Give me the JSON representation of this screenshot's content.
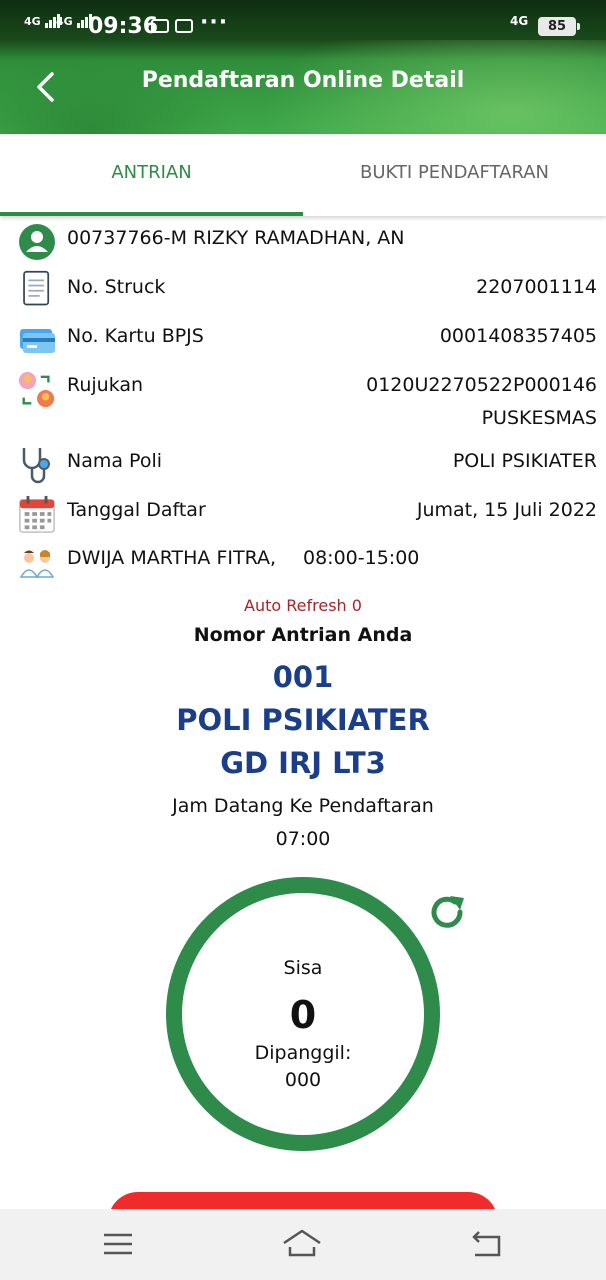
{
  "status_bar": {
    "signal1": "4G",
    "signal2": "4G",
    "time": "09:36",
    "more": "···",
    "network": "4G",
    "battery": "85"
  },
  "header": {
    "title": "Pendaftaran Online Detail",
    "back_icon": "back-arrow-icon"
  },
  "tabs": [
    {
      "label": "ANTRIAN",
      "active": true
    },
    {
      "label": "BUKTI PENDAFTARAN",
      "active": false
    }
  ],
  "patient": {
    "name": "00737766-M RIZKY RAMADHAN, AN",
    "icon": "user-avatar-icon"
  },
  "details": {
    "struck": {
      "label": "No. Struck",
      "value": "2207001114",
      "icon": "receipt-icon"
    },
    "bpjs": {
      "label": "No. Kartu BPJS",
      "value": "0001408357405",
      "icon": "card-icon"
    },
    "rujukan": {
      "label": "Rujukan",
      "value": "0120U2270522P000146",
      "value2": "PUSKESMAS",
      "icon": "referral-icon"
    },
    "poli": {
      "label": "Nama Poli",
      "value": "POLI PSIKIATER",
      "icon": "stethoscope-icon"
    },
    "tanggal": {
      "label": "Tanggal Daftar",
      "value": "Jumat, 15 Juli 2022",
      "icon": "calendar-icon"
    },
    "dokter": {
      "label": "DWIJA MARTHA FITRA,",
      "value": "08:00-15:00",
      "icon": "doctors-icon"
    }
  },
  "queue": {
    "auto_refresh": "Auto Refresh 0",
    "title": "Nomor Antrian Anda",
    "number": "001",
    "poli": "POLI PSIKIATER",
    "location": "GD IRJ LT3",
    "arrival_label": "Jam Datang Ke Pendaftaran",
    "arrival_time": "07:00",
    "remaining_label": "Sisa",
    "remaining": "0",
    "called_label": "Dipanggil:",
    "called": "000",
    "refresh_icon": "refresh-icon"
  },
  "colors": {
    "accent": "#2e8b45",
    "ring": "#2e8b4a",
    "queue_text": "#1a3e8a",
    "refresh_text": "#a6242a",
    "button": "#f02b2b"
  },
  "nav": {
    "menu_icon": "menu-icon",
    "home_icon": "home-icon",
    "back_icon": "back-icon"
  }
}
